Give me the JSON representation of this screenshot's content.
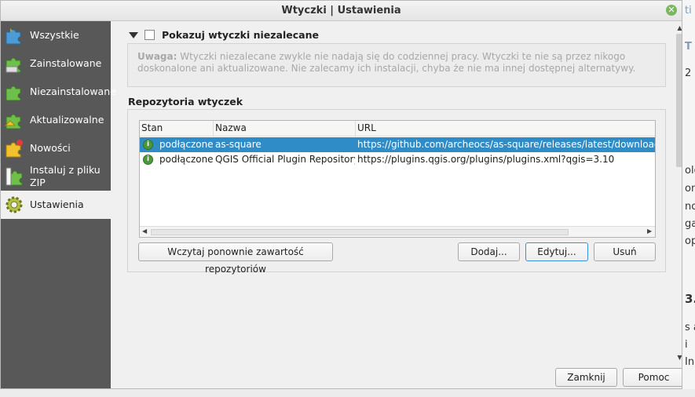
{
  "window": {
    "title": "Wtyczki | Ustawienia"
  },
  "background": {
    "row1": "ti",
    "row2": "T",
    "row3": "2",
    "row4": "olo",
    "row5": "on",
    "row6": "no",
    "row7": "ga",
    "row8": "op",
    "row9": "3.",
    "row10": "s a",
    "row11": "i",
    "row12": "In"
  },
  "sidebar": {
    "items": [
      {
        "label": "Wszystkie",
        "icon": "puzzle-all-icon"
      },
      {
        "label": "Zainstalowane",
        "icon": "puzzle-installed-icon"
      },
      {
        "label": "Niezainstalowane",
        "icon": "puzzle-not-installed-icon"
      },
      {
        "label": "Aktualizowalne",
        "icon": "puzzle-upgradeable-icon"
      },
      {
        "label": "Nowości",
        "icon": "puzzle-new-icon"
      },
      {
        "label": "Instaluj z pliku ZIP",
        "icon": "puzzle-zip-icon"
      },
      {
        "label": "Ustawienia",
        "icon": "gear-icon"
      }
    ]
  },
  "settings": {
    "show_experimental_label": "Pokazuj wtyczki niezalecane",
    "note_bold": "Uwaga:",
    "note_text": " Wtyczki niezalecane zwykle nie nadają się do codziennej pracy. Wtyczki te nie są przez nikogo doskonalone ani aktualizowane. Nie zalecamy ich instalacji, chyba że nie ma innej dostępnej alternatywy.",
    "repositories_title": "Repozytoria wtyczek"
  },
  "table": {
    "headers": [
      "Stan",
      "Nazwa",
      "URL"
    ],
    "rows": [
      {
        "status": "podłączone",
        "name": "as-square",
        "url": "https://github.com/archeocs/as-square/releases/latest/download/pl"
      },
      {
        "status": "podłączone",
        "name": "QGIS Official Plugin Repository",
        "url": "https://plugins.qgis.org/plugins/plugins.xml?qgis=3.10"
      }
    ]
  },
  "buttons": {
    "reload": "Wczytaj ponownie zawartość repozytoriów",
    "add": "Dodaj...",
    "edit": "Edytuj...",
    "delete": "Usuń",
    "close": "Zamknij",
    "help": "Pomoc"
  },
  "colors": {
    "sidebar_bg": "#585858",
    "selection": "#308cc6",
    "status_ok": "#4a9a3a"
  }
}
